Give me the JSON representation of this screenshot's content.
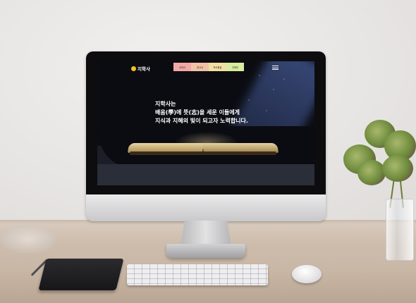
{
  "site": {
    "logo_text": "지학사",
    "nav": [
      {
        "label": "교과서",
        "color": "#f2a9a6"
      },
      {
        "label": "참고서",
        "color": "#f2c2a5"
      },
      {
        "label": "독서평설",
        "color": "#f3dfa1"
      },
      {
        "label": "인재관",
        "color": "#d9ec9f"
      }
    ],
    "menu_icon": "hamburger-icon",
    "headline": [
      "지학사는",
      "배움(學)에 뜻(志)을 세운 이들에게",
      "지식과 지혜의 빛이 되고자 노력합니다."
    ],
    "colors": {
      "logo_dot": "#f4c21c",
      "background": "#0b0c12"
    }
  }
}
